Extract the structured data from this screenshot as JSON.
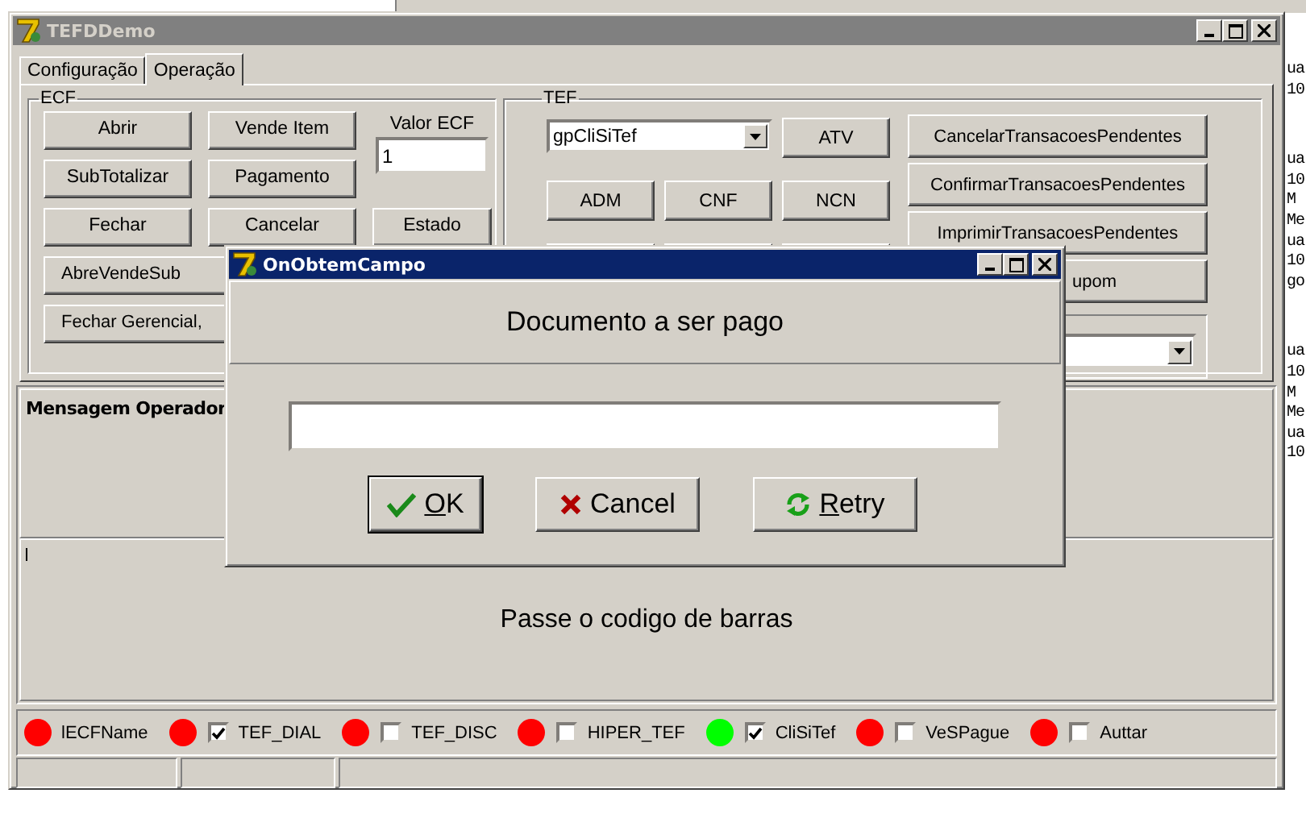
{
  "window": {
    "title": "TEFDDemo"
  },
  "tabs": [
    {
      "label": "Configuração",
      "selected": false
    },
    {
      "label": "Operação",
      "selected": true
    }
  ],
  "ecf": {
    "title": "ECF",
    "valor_label": "Valor ECF",
    "valor_value": "1",
    "buttons": [
      {
        "kind": "normal",
        "label": "Abrir"
      },
      {
        "kind": "normal",
        "label": "Vende Item"
      },
      {
        "kind": "normal",
        "label": "SubTotalizar"
      },
      {
        "kind": "normal",
        "label": "Pagamento"
      },
      {
        "kind": "normal",
        "label": "Fechar"
      },
      {
        "kind": "normal",
        "label": "Cancelar"
      },
      {
        "kind": "normal",
        "label": "Estado"
      },
      {
        "kind": "cut",
        "label": "AbreVendeSub"
      },
      {
        "kind": "cut",
        "label": "Fechar Gerencial,"
      }
    ]
  },
  "tef": {
    "title": "TEF",
    "combo_value": "gpCliSiTef",
    "buttons": [
      {
        "kind": "normal",
        "label": "ATV"
      },
      {
        "kind": "normal",
        "label": "ADM"
      },
      {
        "kind": "normal",
        "label": "CNF"
      },
      {
        "kind": "normal",
        "label": "NCN"
      },
      {
        "kind": "blank"
      },
      {
        "kind": "blank"
      },
      {
        "kind": "blank"
      }
    ],
    "side_buttons": [
      {
        "kind": "normal",
        "label": "CancelarTransacoesPendentes"
      },
      {
        "kind": "normal",
        "label": "ConfirmarTransacoesPendentes"
      },
      {
        "kind": "normal",
        "label": "ImprimirTransacoesPendentes"
      },
      {
        "kind": "cut",
        "label": "upom"
      }
    ]
  },
  "message_panel": {
    "title": "Mensagem Operador",
    "message": "Passe o codigo de barras"
  },
  "status_indicators": [
    {
      "kind": "label",
      "label": "lECFName",
      "color": "#ff0000"
    },
    {
      "kind": "check",
      "label": "TEF_DIAL",
      "color": "#ff0000",
      "checked": true
    },
    {
      "kind": "check",
      "label": "TEF_DISC",
      "color": "#ff0000",
      "checked": false
    },
    {
      "kind": "check",
      "label": "HIPER_TEF",
      "color": "#ff0000",
      "checked": false
    },
    {
      "kind": "check",
      "label": "CliSiTef",
      "color": "#00ff00",
      "checked": true
    },
    {
      "kind": "check",
      "label": "VeSPague",
      "color": "#ff0000",
      "checked": false
    },
    {
      "kind": "check",
      "label": "Auttar",
      "color": "#ff0000",
      "checked": false
    }
  ],
  "dialog": {
    "title": "OnObtemCampo",
    "prompt": "Documento a ser pago",
    "buttons": [
      {
        "kind": "ok",
        "label": "OK",
        "default": true,
        "accelerator": true
      },
      {
        "kind": "cancel",
        "label": "Cancel",
        "default": false,
        "accelerator": false
      },
      {
        "kind": "retry",
        "label": "Retry",
        "default": false,
        "accelerator": true
      }
    ]
  },
  "background_fragments": [
    [
      "ua",
      "10"
    ],
    [
      "ua",
      "10",
      "M",
      "Me",
      "ua",
      "10",
      "go"
    ],
    [
      "ua",
      "10",
      "M",
      "Me",
      "ua",
      "10"
    ]
  ]
}
